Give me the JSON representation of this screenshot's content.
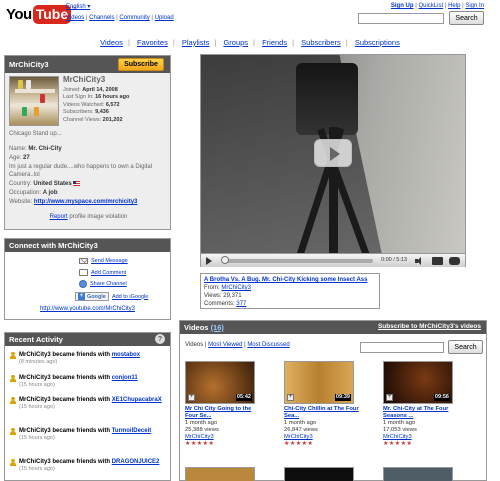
{
  "header": {
    "logo_you": "You",
    "logo_tube": "Tube",
    "logo_tm": "™",
    "language": "English ▾",
    "top_links": [
      "Videos",
      "Channels",
      "Community",
      "Upload"
    ],
    "user_links": [
      "Sign Up",
      "QuickList",
      "Help",
      "Sign In"
    ],
    "search_button": "Search"
  },
  "channel_nav": [
    "Videos",
    "Favorites",
    "Playlists",
    "Groups",
    "Friends",
    "Subscribers",
    "Subscriptions"
  ],
  "profile": {
    "title": "MrChiCity3",
    "subscribe_label": "Subscribe",
    "name": "MrChiCity3",
    "joined_label": "Joined:",
    "joined": "April 14, 2008",
    "last_sign_in_label": "Last Sign In:",
    "last_sign_in": "16 hours ago",
    "videos_watched_label": "Videos Watched:",
    "videos_watched": "6,572",
    "subscribers_label": "Subscribers:",
    "subscribers": "9,436",
    "channel_views_label": "Channel Views:",
    "channel_views": "201,202",
    "tagline": "Chicago Stand up...",
    "name_label": "Name:",
    "real_name": "Mr. Chi-City",
    "age_label": "Age:",
    "age": "27",
    "about": "Im just a regular dude....who happens to own a Digital Camera..lol",
    "country_label": "Country:",
    "country": "United States",
    "occupation_label": "Occupation:",
    "occupation": "A job",
    "website_label": "Website:",
    "website": "http://www.myspace.com/mrchicity3",
    "report_link": "Report",
    "report_text": "profile image violation"
  },
  "connect": {
    "title": "Connect with MrChiCity3",
    "send_message": "Send Message",
    "add_comment": "Add Comment",
    "share_channel": "Share Channel",
    "google_label": "Google",
    "add_to_igoogle": "Add to iGoogle",
    "channel_url": "http://www.youtube.com/MrChiCity3"
  },
  "activity": {
    "title": "Recent Activity",
    "help": "?",
    "items": [
      {
        "text": "MrChiCity3 became friends with",
        "friend": "mostabox",
        "when": "(8 minutes ago)"
      },
      {
        "text": "MrChiCity3 became friends with",
        "friend": "conjon11",
        "when": "(15 hours ago)"
      },
      {
        "text": "MrChiCity3 became friends with",
        "friend": "XE1ChupacabraX",
        "when": "(15 hours ago)"
      },
      {
        "text": "MrChiCity3 became friends with",
        "friend": "TurmoilDeceit",
        "when": "(15 hours ago)"
      },
      {
        "text": "MrChiCity3 became friends with",
        "friend": "DRAGONJUICE2",
        "when": "(15 hours ago)"
      }
    ]
  },
  "player": {
    "time": "0:00 / 5:13"
  },
  "featured": {
    "title": "A Brotha Vs. A Bug. Mr. Chi-City Kicking some Insect Ass",
    "from_label": "From:",
    "from": "MrChiCity3",
    "views_label": "Views:",
    "views": "29,371",
    "comments_label": "Comments:",
    "comments": "377"
  },
  "videos": {
    "title": "Videos",
    "count": "(16)",
    "subscribe_link": "Subscribe to MrChiCity3's videos",
    "sort_links": [
      "Videos",
      "Most Viewed",
      "Most Discussed"
    ],
    "search_button": "Search",
    "items": [
      {
        "duration": "05:42",
        "title": "Mr Chi City Going to the Four Se...",
        "age": "1 month ago",
        "views": "25,388 views",
        "user": "MrChiCity3",
        "stars": "★★★★★",
        "thumb": "#7a4a20"
      },
      {
        "duration": "09:39",
        "title": "Chi-City Chillin at The Four Sea...",
        "age": "1 month ago",
        "views": "26,847 views",
        "user": "MrChiCity3",
        "stars": "★★★★★",
        "thumb": "#c48a3a"
      },
      {
        "duration": "09:56",
        "title": "Mr. Chi-City at The Four Seasons ...",
        "age": "1 month ago",
        "views": "17,053 views",
        "user": "MrChiCity3",
        "stars": "★★★★★",
        "thumb": "#2a1206"
      }
    ]
  }
}
